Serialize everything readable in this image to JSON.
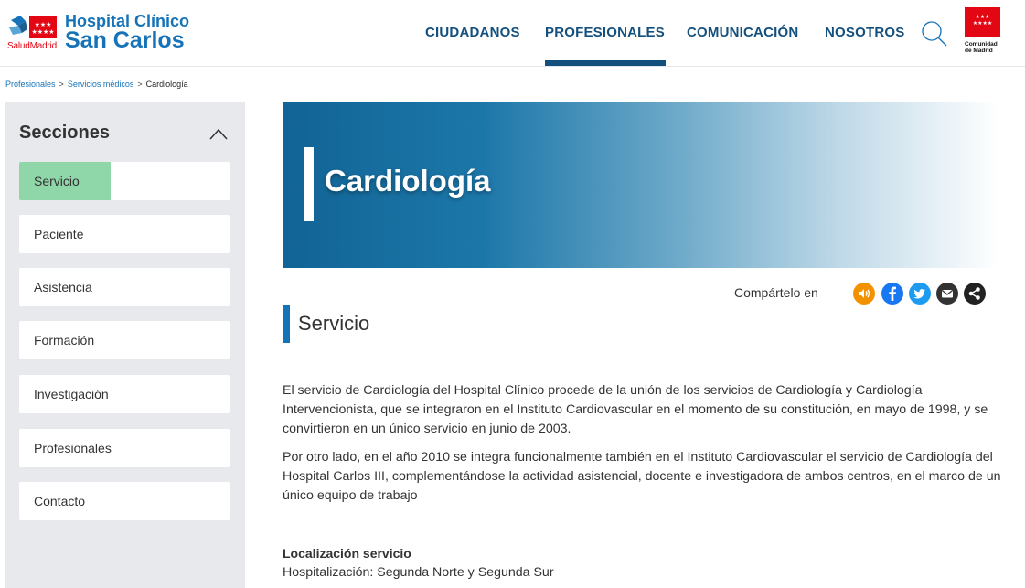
{
  "header": {
    "logo_sub": "SaludMadrid",
    "logo_line1": "Hospital Clínico",
    "logo_line2": "San Carlos",
    "nav": [
      "CIUDADANOS",
      "PROFESIONALES",
      "COMUNICACIÓN",
      "NOSOTROS"
    ],
    "active_nav": "PROFESIONALES",
    "region_logo_line1": "Comunidad",
    "region_logo_line2": "de Madrid"
  },
  "breadcrumb": {
    "items": [
      "Profesionales",
      "Servicios médicos",
      "Cardiología"
    ],
    "separator": ">"
  },
  "sidebar": {
    "title": "Secciones",
    "items": [
      {
        "label": "Servicio",
        "active": true
      },
      {
        "label": "Paciente"
      },
      {
        "label": "Asistencia"
      },
      {
        "label": "Formación"
      },
      {
        "label": "Investigación"
      },
      {
        "label": "Profesionales"
      },
      {
        "label": "Contacto"
      }
    ]
  },
  "hero": {
    "title": "Cardiología"
  },
  "share": {
    "label": "Compártelo en",
    "icons": [
      "listen-icon",
      "facebook-icon",
      "twitter-icon",
      "email-icon",
      "share-icon"
    ]
  },
  "section": {
    "title": "Servicio"
  },
  "content": {
    "p1": "El servicio de Cardiología del Hospital Clínico procede de la unión de los servicios de Cardiología y Cardiología Intervencionista, que se integraron en el Instituto Cardiovascular en el momento de su constitución, en mayo de 1998, y se convirtieron en un único servicio en junio de 2003.",
    "p2": "Por otro lado, en el año 2010 se integra funcionalmente también en el Instituto Cardiovascular el servicio de Cardiología del Hospital Carlos III, complementándose la actividad asistencial, docente e investigadora de ambos centros, en el marco de un único equipo de trabajo",
    "location_title": "Localización servicio",
    "location_text": "Hospitalización: Segunda Norte y Segunda Sur"
  },
  "colors": {
    "brand_blue": "#1673b8",
    "nav_dark": "#14507e",
    "active_green": "#8fd6a8",
    "madrid_red": "#e30613",
    "listen_orange": "#f39200"
  }
}
